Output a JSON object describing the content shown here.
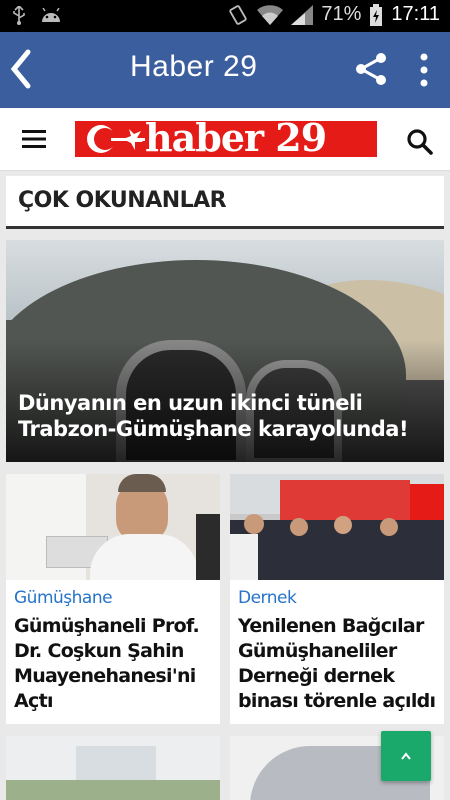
{
  "status_bar": {
    "battery_percent": "71%",
    "time": "17:11",
    "icons": [
      "usb-icon",
      "android-icon",
      "vibrate-icon",
      "wifi-icon",
      "signal-icon",
      "battery-icon"
    ]
  },
  "app_bar": {
    "title": "Haber 29",
    "color": "#3b5e9e",
    "icons": [
      "back-icon",
      "share-icon",
      "more-vert-icon"
    ]
  },
  "site_header": {
    "logo_text": "haber 29",
    "logo_color": "#e41b17",
    "icons": [
      "hamburger-menu-icon",
      "search-icon"
    ]
  },
  "section": {
    "title": "ÇOK OKUNANLAR"
  },
  "hero": {
    "headline": "Dünyanın en uzun ikinci tüneli Trabzon-Gümüşhane karayolunda!"
  },
  "articles": [
    {
      "category": "Gümüşhane",
      "title": "Gümüşhaneli Prof. Dr. Coşkun Şahin Muayenehanesi'ni Açtı"
    },
    {
      "category": "Dernek",
      "title": "Yenilenen Bağcılar Gümüşhaneliler Derneği dernek binası törenle açıldı"
    }
  ],
  "accent_colors": {
    "category": "#2673c9",
    "fab": "#1aa96a"
  }
}
